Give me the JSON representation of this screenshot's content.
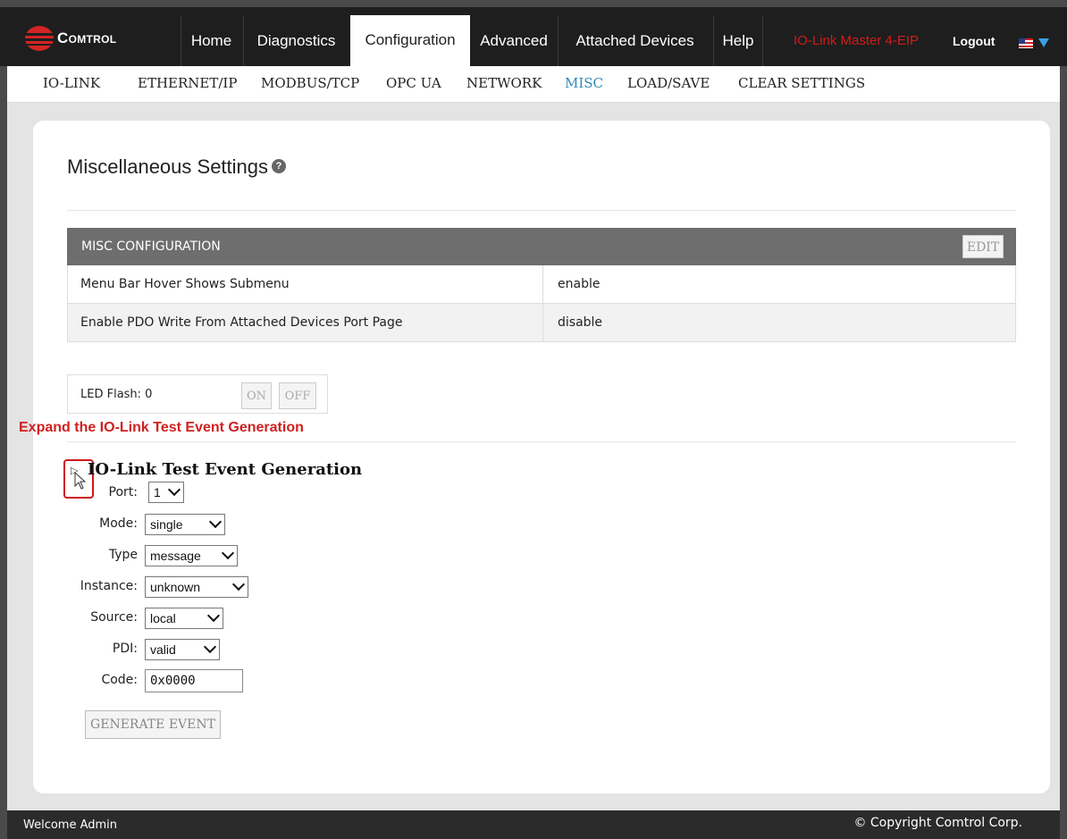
{
  "brand": {
    "name": "Comtrol"
  },
  "nav": {
    "items": [
      "Home",
      "Diagnostics",
      "Configuration",
      "Advanced",
      "Attached Devices",
      "Help"
    ],
    "active": "Configuration",
    "device_name": "IO-Link Master 4-EIP",
    "logout_label": "Logout"
  },
  "subnav": {
    "items": [
      "IO-LINK",
      "ETHERNET/IP",
      "MODBUS/TCP",
      "OPC UA",
      "NETWORK",
      "MISC",
      "LOAD/SAVE",
      "CLEAR SETTINGS"
    ],
    "active": "MISC"
  },
  "page": {
    "title": "Miscellaneous Settings"
  },
  "misc_config": {
    "header": "MISC CONFIGURATION",
    "edit_label": "EDIT",
    "rows": [
      {
        "label": "Menu Bar Hover Shows Submenu",
        "value": "enable"
      },
      {
        "label": "Enable PDO Write From Attached Devices Port Page",
        "value": "disable"
      }
    ]
  },
  "led": {
    "label": "LED Flash: 0",
    "on_label": "ON",
    "off_label": "OFF"
  },
  "annotation": "Expand the IO-Link Test Event Generation",
  "test_event": {
    "title": "IO-Link Test Event Generation",
    "port": {
      "label": "Port:",
      "value": "1"
    },
    "mode": {
      "label": "Mode:",
      "value": "single"
    },
    "type": {
      "label": "Type",
      "value": "message"
    },
    "instance": {
      "label": "Instance:",
      "value": "unknown"
    },
    "source": {
      "label": "Source:",
      "value": "local"
    },
    "pdi": {
      "label": "PDI:",
      "value": "valid"
    },
    "code": {
      "label": "Code:",
      "value": "0x0000"
    },
    "generate_label": "GENERATE EVENT"
  },
  "footer": {
    "welcome": "Welcome Admin",
    "copyright": "© Copyright Comtrol Corp."
  },
  "colors": {
    "nav_bg": "#1e1e1e",
    "device_name": "#e21d1d",
    "active_sub": "#2e8ab8",
    "annotation": "#d12020",
    "table_header": "#6e6e6e"
  }
}
